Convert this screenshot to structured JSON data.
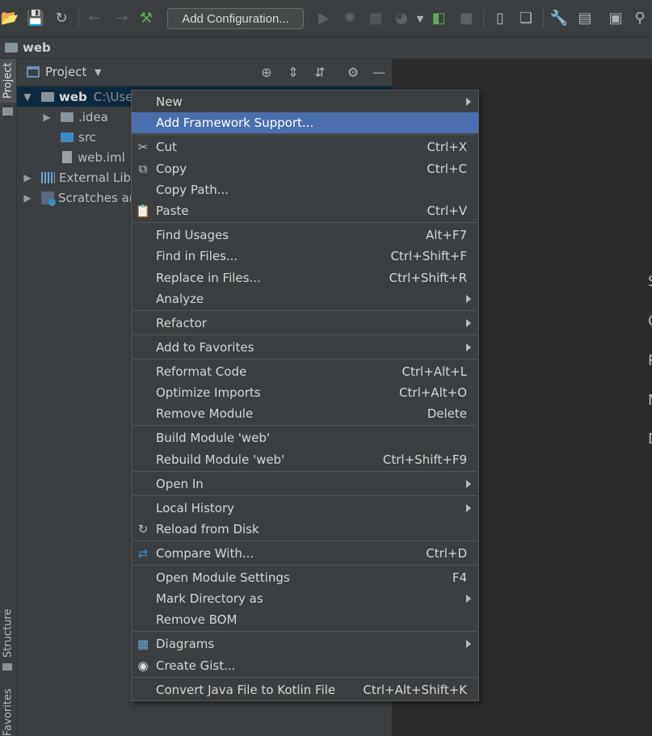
{
  "toolbar": {
    "add_configuration": "Add Configuration...",
    "icons": [
      "open-folder-icon",
      "save-icon",
      "sync-icon",
      "back-arrow-icon",
      "forward-arrow-icon",
      "build-hammer-icon",
      "run-icon",
      "debug-icon",
      "coverage-icon",
      "profile-icon",
      "dropdown-icon",
      "attach-debugger-icon",
      "stop-icon",
      "device-icon",
      "sdk-box-icon",
      "wrench-icon",
      "project-structure-icon",
      "terminal-icon",
      "search-icon"
    ]
  },
  "breadcrumb": {
    "label": "web"
  },
  "left_strip": {
    "project_tab": "Project",
    "structure_tab": "Structure",
    "favorites_tab": "Favorites"
  },
  "project_panel": {
    "title": "Project",
    "tree": [
      {
        "label": "web",
        "path": "C:\\Use"
      },
      {
        "label": ".idea"
      },
      {
        "label": "src"
      },
      {
        "label": "web.iml"
      },
      {
        "label": "External Libr"
      },
      {
        "label": "Scratches ar"
      }
    ]
  },
  "editor": {
    "edge_letters": [
      "S",
      "G",
      "R",
      "N",
      "D"
    ]
  },
  "menu": {
    "items": [
      {
        "label": "New",
        "shortcut": "",
        "submenu": true
      },
      {
        "label": "Add Framework Support...",
        "shortcut": "",
        "submenu": false,
        "highlighted": true
      },
      {
        "label": "Cut",
        "shortcut": "Ctrl+X",
        "icon": "scissors-icon"
      },
      {
        "label": "Copy",
        "shortcut": "Ctrl+C",
        "icon": "copy-icon"
      },
      {
        "label": "Copy Path...",
        "shortcut": ""
      },
      {
        "label": "Paste",
        "shortcut": "Ctrl+V",
        "icon": "paste-icon"
      },
      {
        "label": "Find Usages",
        "shortcut": "Alt+F7"
      },
      {
        "label": "Find in Files...",
        "shortcut": "Ctrl+Shift+F"
      },
      {
        "label": "Replace in Files...",
        "shortcut": "Ctrl+Shift+R"
      },
      {
        "label": "Analyze",
        "shortcut": "",
        "submenu": true
      },
      {
        "label": "Refactor",
        "shortcut": "",
        "submenu": true
      },
      {
        "label": "Add to Favorites",
        "shortcut": "",
        "submenu": true
      },
      {
        "label": "Reformat Code",
        "shortcut": "Ctrl+Alt+L"
      },
      {
        "label": "Optimize Imports",
        "shortcut": "Ctrl+Alt+O"
      },
      {
        "label": "Remove Module",
        "shortcut": "Delete"
      },
      {
        "label": "Build Module 'web'",
        "shortcut": ""
      },
      {
        "label": "Rebuild Module 'web'",
        "shortcut": "Ctrl+Shift+F9"
      },
      {
        "label": "Open In",
        "shortcut": "",
        "submenu": true
      },
      {
        "label": "Local History",
        "shortcut": "",
        "submenu": true
      },
      {
        "label": "Reload from Disk",
        "shortcut": "",
        "icon": "reload-icon"
      },
      {
        "label": "Compare With...",
        "shortcut": "Ctrl+D",
        "icon": "compare-icon"
      },
      {
        "label": "Open Module Settings",
        "shortcut": "F4"
      },
      {
        "label": "Mark Directory as",
        "shortcut": "",
        "submenu": true
      },
      {
        "label": "Remove BOM",
        "shortcut": ""
      },
      {
        "label": "Diagrams",
        "shortcut": "",
        "submenu": true,
        "icon": "diagrams-icon"
      },
      {
        "label": "Create Gist...",
        "shortcut": "",
        "icon": "github-icon"
      },
      {
        "label": "Convert Java File to Kotlin File",
        "shortcut": "Ctrl+Alt+Shift+K"
      }
    ]
  },
  "colors": {
    "highlight": "#4b6eaf",
    "panel": "#3c3f41",
    "editor": "#2b2b2b",
    "selection": "#0d293e"
  }
}
